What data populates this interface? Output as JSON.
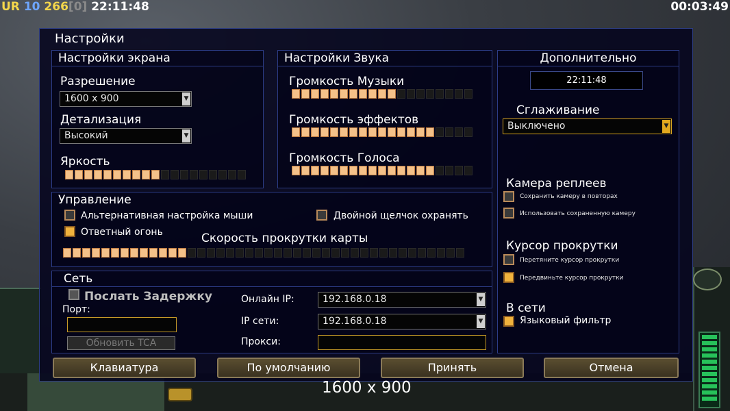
{
  "hud": {
    "ur": "UR",
    "level": "10",
    "money": "266",
    "bracket": "[0]",
    "clock": "22:11:48",
    "elapsed": "00:03:49"
  },
  "dialog": {
    "title": "Настройки"
  },
  "screen": {
    "header": "Настройки экрана",
    "resolution_label": "Разрешение",
    "resolution_value": "1600 x 900",
    "detail_label": "Детализация",
    "detail_value": "Высокий",
    "brightness_label": "Яркость",
    "brightness_level": 0.52
  },
  "sound": {
    "header": "Настройки Звука",
    "music_label": "Громкость Музыки",
    "music_level": 0.58,
    "effects_label": "Громкость эффектов",
    "effects_level": 0.81,
    "voice_label": "Громкость Голоса",
    "voice_level": 0.77
  },
  "extra": {
    "header": "Дополнительно",
    "clock": "22:11:48",
    "aa_label": "Сглаживание",
    "aa_value": "Выключено",
    "replay_cam_label": "Камера реплеев",
    "save_cam_label": "Сохранить камеру в повторах",
    "use_saved_cam_label": "Использовать сохраненную камеру",
    "scroll_cursor_label": "Курсор прокрутки",
    "drag_cursor_label": "Перетяните курсор прокрутки",
    "move_cursor_label": "Передвиньте курсор прокрутки",
    "online_label": "В сети",
    "lang_filter_label": "Языковый фильтр"
  },
  "control": {
    "header": "Управление",
    "alt_mouse_label": "Альтернативная настройка мыши",
    "double_click_label": "Двойной щелчок охранять",
    "return_fire_label": "Ответный огонь",
    "scroll_speed_label": "Скорость прокрутки карты",
    "scroll_speed_level": 0.3
  },
  "network": {
    "header": "Сеть",
    "send_delay_label": "Послать Задержку",
    "port_label": "Порт:",
    "update_tca_label": "Обновить TCA",
    "online_ip_label": "Онлайн IP:",
    "online_ip_value": "192.168.0.18",
    "lan_ip_label": "IP сети:",
    "lan_ip_value": "192.168.0.18",
    "proxy_label": "Прокси:"
  },
  "buttons": {
    "keyboard": "Клавиатура",
    "defaults": "По умолчанию",
    "accept": "Принять",
    "cancel": "Отмена"
  },
  "footer": {
    "resolution_text": "1600 x 900"
  }
}
